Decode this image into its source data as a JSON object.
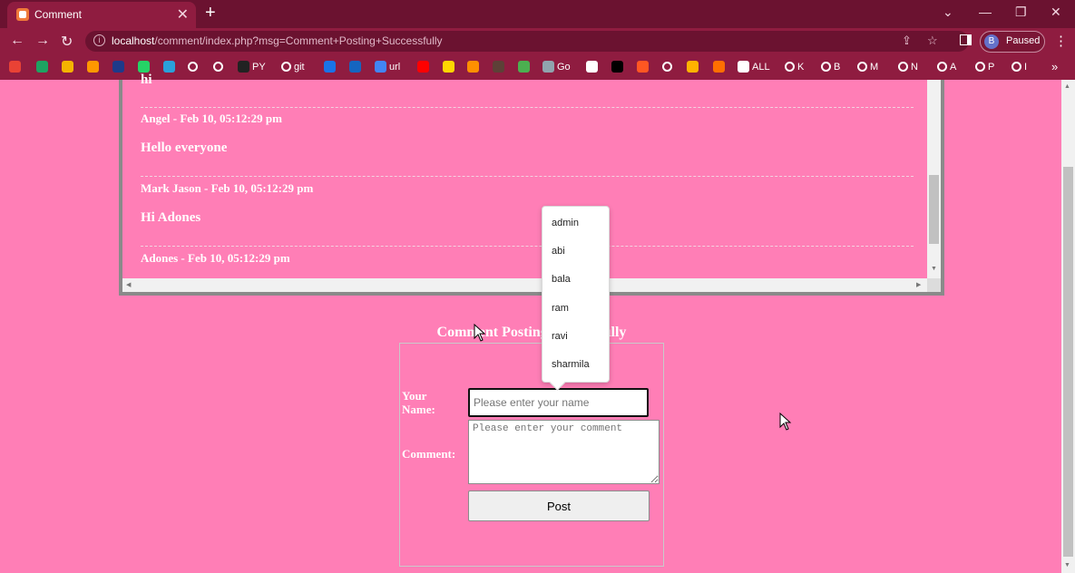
{
  "browser": {
    "tab": {
      "title": "Comment",
      "close_glyph": "✕"
    },
    "new_tab_glyph": "+",
    "window_controls": {
      "minimize": "—",
      "restore": "❐",
      "close": "✕",
      "tabsearch": "⌄"
    },
    "url": {
      "host": "localhost",
      "path": "/comment/index.php?msg=Comment+Posting+Successfully"
    },
    "profile": {
      "initial": "B",
      "label": "Paused"
    },
    "bookmarks": [
      {
        "label": "",
        "color": "#e94235"
      },
      {
        "label": "",
        "color": "#1ea362"
      },
      {
        "label": "",
        "color": "#f4b400"
      },
      {
        "label": "",
        "color": "#ff9800"
      },
      {
        "label": "",
        "color": "#1e3a8a"
      },
      {
        "label": "",
        "color": "#25d366"
      },
      {
        "label": "",
        "color": "#2aa1da"
      },
      {
        "label": "",
        "color": "google"
      },
      {
        "label": "",
        "color": "google"
      },
      {
        "label": "PY",
        "color": "#222222"
      },
      {
        "label": "git",
        "color": "google"
      },
      {
        "label": "",
        "color": "#1a73e8"
      },
      {
        "label": "",
        "color": "#1565c0"
      },
      {
        "label": "url",
        "color": "#4285f4"
      },
      {
        "label": "",
        "color": "#ff0000"
      },
      {
        "label": "",
        "color": "#ffd600"
      },
      {
        "label": "",
        "color": "#ff8f00"
      },
      {
        "label": "",
        "color": "#5d4037"
      },
      {
        "label": "",
        "color": "#4caf50"
      },
      {
        "label": "Go",
        "color": "#90a4ae"
      },
      {
        "label": "",
        "color": "#ffffff"
      },
      {
        "label": "",
        "color": "#000000"
      },
      {
        "label": "",
        "color": "#ff5722"
      },
      {
        "label": "",
        "color": "google"
      },
      {
        "label": "",
        "color": "#ffb300"
      },
      {
        "label": "",
        "color": "#ff6f00"
      },
      {
        "label": "ALL",
        "color": "#ffffff"
      },
      {
        "label": "K",
        "color": "google"
      },
      {
        "label": "B",
        "color": "google"
      },
      {
        "label": "M",
        "color": "google"
      },
      {
        "label": "N",
        "color": "google"
      },
      {
        "label": "A",
        "color": "google"
      },
      {
        "label": "P",
        "color": "google"
      },
      {
        "label": "I",
        "color": "google"
      }
    ],
    "bookmarks_more": "»"
  },
  "comments": {
    "cut_off_text": "hi",
    "entries": [
      {
        "meta": "Angel - Feb 10, 05:12:29 pm",
        "message": "Hello everyone"
      },
      {
        "meta": "Mark Jason - Feb 10, 05:12:29 pm",
        "message": "Hi Adones"
      },
      {
        "meta": "Adones - Feb 10, 05:12:29 pm",
        "message": ""
      }
    ]
  },
  "form": {
    "heading": "Comment Posting Successfully",
    "name_label": "Your Name:",
    "name_placeholder": "Please enter your name",
    "comment_label": "Comment:",
    "comment_placeholder": "Please enter your comment",
    "post_label": "Post"
  },
  "autocomplete": {
    "options": [
      "admin",
      "abi",
      "bala",
      "ram",
      "ravi",
      "sharmila"
    ]
  },
  "colors": {
    "page_bg": "#ff7eb6",
    "chrome_dark": "#6b1230",
    "chrome_mid": "#8f1c40"
  }
}
